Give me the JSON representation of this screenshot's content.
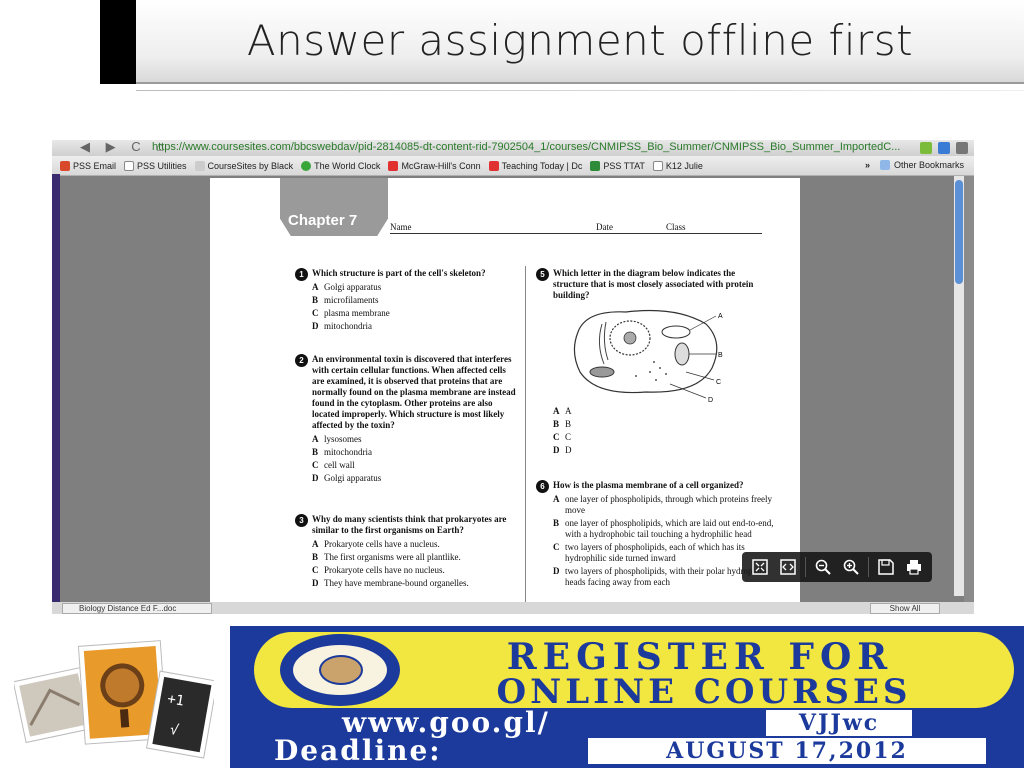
{
  "slide": {
    "title": "Answer assignment offline first"
  },
  "browser": {
    "url": "https://www.coursesites.com/bbcswebdav/pid-2814085-dt-content-rid-7902504_1/courses/CNMIPSS_Bio_Summer/CNMIPSS_Bio_Summer_ImportedC...",
    "nav_glyphs": "◀ ▶ C ⌂",
    "bookmarks": [
      {
        "label": "PSS Email",
        "color": "#d84a2a"
      },
      {
        "label": "PSS Utilities",
        "color": "#ffffff"
      },
      {
        "label": "CourseSites by Black",
        "color": "#cccccc"
      },
      {
        "label": "The World Clock",
        "color": "#3aa63a"
      },
      {
        "label": "McGraw-Hill's Conn",
        "color": "#e03030"
      },
      {
        "label": "Teaching Today | Dc",
        "color": "#e03030"
      },
      {
        "label": "PSS TTAT",
        "color": "#2e8b3a"
      },
      {
        "label": "K12 Julie",
        "color": "#ffffff"
      }
    ],
    "other_bookmarks": "Other Bookmarks",
    "chevron": "»",
    "status_tab": "Biology Distance Ed F...doc",
    "status_right": "Show All"
  },
  "worksheet": {
    "chapter": "Chapter 7",
    "name_label": "Name",
    "date_label": "Date",
    "class_label": "Class",
    "questions": [
      {
        "num": "1",
        "stem": "Which structure is part of the cell's skeleton?",
        "options": [
          {
            "letter": "A",
            "text": "Golgi apparatus"
          },
          {
            "letter": "B",
            "text": "microfilaments"
          },
          {
            "letter": "C",
            "text": "plasma membrane"
          },
          {
            "letter": "D",
            "text": "mitochondria"
          }
        ]
      },
      {
        "num": "2",
        "stem": "An environmental toxin is discovered that interferes with certain cellular functions. When affected cells are examined, it is observed that proteins that are normally found on the plasma membrane are instead found in the cytoplasm. Other proteins are also located improperly. Which structure is most likely affected by the toxin?",
        "options": [
          {
            "letter": "A",
            "text": "lysosomes"
          },
          {
            "letter": "B",
            "text": "mitochondria"
          },
          {
            "letter": "C",
            "text": "cell wall"
          },
          {
            "letter": "D",
            "text": "Golgi apparatus"
          }
        ]
      },
      {
        "num": "3",
        "stem": "Why do many scientists think that prokaryotes are similar to the first organisms on Earth?",
        "options": [
          {
            "letter": "A",
            "text": "Prokaryote cells have a nucleus."
          },
          {
            "letter": "B",
            "text": "The first organisms were all plantlike."
          },
          {
            "letter": "C",
            "text": "Prokaryote cells have no nucleus."
          },
          {
            "letter": "D",
            "text": "They have membrane-bound organelles."
          }
        ]
      },
      {
        "num": "5",
        "stem": "Which letter in the diagram below indicates the structure that is most closely associated with protein building?",
        "options": [
          {
            "letter": "A",
            "text": "A"
          },
          {
            "letter": "B",
            "text": "B"
          },
          {
            "letter": "C",
            "text": "C"
          },
          {
            "letter": "D",
            "text": "D"
          }
        ]
      },
      {
        "num": "6",
        "stem": "How is the plasma membrane of a cell organized?",
        "options": [
          {
            "letter": "A",
            "text": "one layer of phospholipids, through which proteins freely move"
          },
          {
            "letter": "B",
            "text": "one layer of phospholipids, which are laid out end-to-end, with a hydrophobic tail touching a hydrophilic head"
          },
          {
            "letter": "C",
            "text": "two layers of phospholipids, each of which has its hydrophilic side turned inward"
          },
          {
            "letter": "D",
            "text": "two layers of phospholipids, with their polar hydrophilic heads facing away from each"
          }
        ]
      }
    ],
    "diagram_labels": [
      "A",
      "B",
      "C",
      "D"
    ]
  },
  "banner": {
    "line1": "REGISTER FOR",
    "line2": "ONLINE COURSES",
    "url": "www.goo.gl/",
    "url_code": "VJJwc",
    "deadline_label": "Deadline:",
    "deadline_date": "AUGUST 17,2012",
    "colors": {
      "blue": "#1c3a9c",
      "yellow": "#f2e640"
    }
  }
}
